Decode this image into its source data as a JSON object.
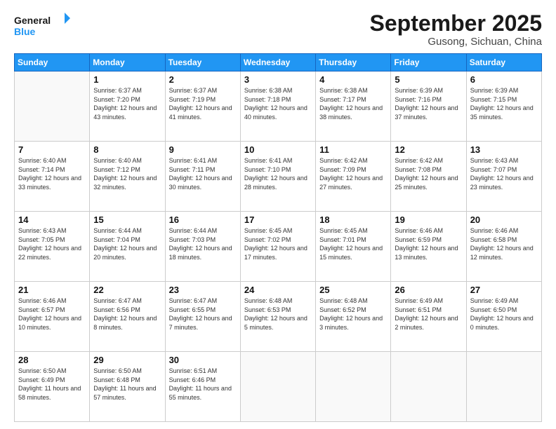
{
  "header": {
    "logo_line1": "General",
    "logo_line2": "Blue",
    "title": "September 2025",
    "subtitle": "Gusong, Sichuan, China"
  },
  "days_of_week": [
    "Sunday",
    "Monday",
    "Tuesday",
    "Wednesday",
    "Thursday",
    "Friday",
    "Saturday"
  ],
  "weeks": [
    [
      {
        "day": "",
        "info": ""
      },
      {
        "day": "1",
        "info": "Sunrise: 6:37 AM\nSunset: 7:20 PM\nDaylight: 12 hours and 43 minutes."
      },
      {
        "day": "2",
        "info": "Sunrise: 6:37 AM\nSunset: 7:19 PM\nDaylight: 12 hours and 41 minutes."
      },
      {
        "day": "3",
        "info": "Sunrise: 6:38 AM\nSunset: 7:18 PM\nDaylight: 12 hours and 40 minutes."
      },
      {
        "day": "4",
        "info": "Sunrise: 6:38 AM\nSunset: 7:17 PM\nDaylight: 12 hours and 38 minutes."
      },
      {
        "day": "5",
        "info": "Sunrise: 6:39 AM\nSunset: 7:16 PM\nDaylight: 12 hours and 37 minutes."
      },
      {
        "day": "6",
        "info": "Sunrise: 6:39 AM\nSunset: 7:15 PM\nDaylight: 12 hours and 35 minutes."
      }
    ],
    [
      {
        "day": "7",
        "info": "Sunrise: 6:40 AM\nSunset: 7:14 PM\nDaylight: 12 hours and 33 minutes."
      },
      {
        "day": "8",
        "info": "Sunrise: 6:40 AM\nSunset: 7:12 PM\nDaylight: 12 hours and 32 minutes."
      },
      {
        "day": "9",
        "info": "Sunrise: 6:41 AM\nSunset: 7:11 PM\nDaylight: 12 hours and 30 minutes."
      },
      {
        "day": "10",
        "info": "Sunrise: 6:41 AM\nSunset: 7:10 PM\nDaylight: 12 hours and 28 minutes."
      },
      {
        "day": "11",
        "info": "Sunrise: 6:42 AM\nSunset: 7:09 PM\nDaylight: 12 hours and 27 minutes."
      },
      {
        "day": "12",
        "info": "Sunrise: 6:42 AM\nSunset: 7:08 PM\nDaylight: 12 hours and 25 minutes."
      },
      {
        "day": "13",
        "info": "Sunrise: 6:43 AM\nSunset: 7:07 PM\nDaylight: 12 hours and 23 minutes."
      }
    ],
    [
      {
        "day": "14",
        "info": "Sunrise: 6:43 AM\nSunset: 7:05 PM\nDaylight: 12 hours and 22 minutes."
      },
      {
        "day": "15",
        "info": "Sunrise: 6:44 AM\nSunset: 7:04 PM\nDaylight: 12 hours and 20 minutes."
      },
      {
        "day": "16",
        "info": "Sunrise: 6:44 AM\nSunset: 7:03 PM\nDaylight: 12 hours and 18 minutes."
      },
      {
        "day": "17",
        "info": "Sunrise: 6:45 AM\nSunset: 7:02 PM\nDaylight: 12 hours and 17 minutes."
      },
      {
        "day": "18",
        "info": "Sunrise: 6:45 AM\nSunset: 7:01 PM\nDaylight: 12 hours and 15 minutes."
      },
      {
        "day": "19",
        "info": "Sunrise: 6:46 AM\nSunset: 6:59 PM\nDaylight: 12 hours and 13 minutes."
      },
      {
        "day": "20",
        "info": "Sunrise: 6:46 AM\nSunset: 6:58 PM\nDaylight: 12 hours and 12 minutes."
      }
    ],
    [
      {
        "day": "21",
        "info": "Sunrise: 6:46 AM\nSunset: 6:57 PM\nDaylight: 12 hours and 10 minutes."
      },
      {
        "day": "22",
        "info": "Sunrise: 6:47 AM\nSunset: 6:56 PM\nDaylight: 12 hours and 8 minutes."
      },
      {
        "day": "23",
        "info": "Sunrise: 6:47 AM\nSunset: 6:55 PM\nDaylight: 12 hours and 7 minutes."
      },
      {
        "day": "24",
        "info": "Sunrise: 6:48 AM\nSunset: 6:53 PM\nDaylight: 12 hours and 5 minutes."
      },
      {
        "day": "25",
        "info": "Sunrise: 6:48 AM\nSunset: 6:52 PM\nDaylight: 12 hours and 3 minutes."
      },
      {
        "day": "26",
        "info": "Sunrise: 6:49 AM\nSunset: 6:51 PM\nDaylight: 12 hours and 2 minutes."
      },
      {
        "day": "27",
        "info": "Sunrise: 6:49 AM\nSunset: 6:50 PM\nDaylight: 12 hours and 0 minutes."
      }
    ],
    [
      {
        "day": "28",
        "info": "Sunrise: 6:50 AM\nSunset: 6:49 PM\nDaylight: 11 hours and 58 minutes."
      },
      {
        "day": "29",
        "info": "Sunrise: 6:50 AM\nSunset: 6:48 PM\nDaylight: 11 hours and 57 minutes."
      },
      {
        "day": "30",
        "info": "Sunrise: 6:51 AM\nSunset: 6:46 PM\nDaylight: 11 hours and 55 minutes."
      },
      {
        "day": "",
        "info": ""
      },
      {
        "day": "",
        "info": ""
      },
      {
        "day": "",
        "info": ""
      },
      {
        "day": "",
        "info": ""
      }
    ]
  ]
}
